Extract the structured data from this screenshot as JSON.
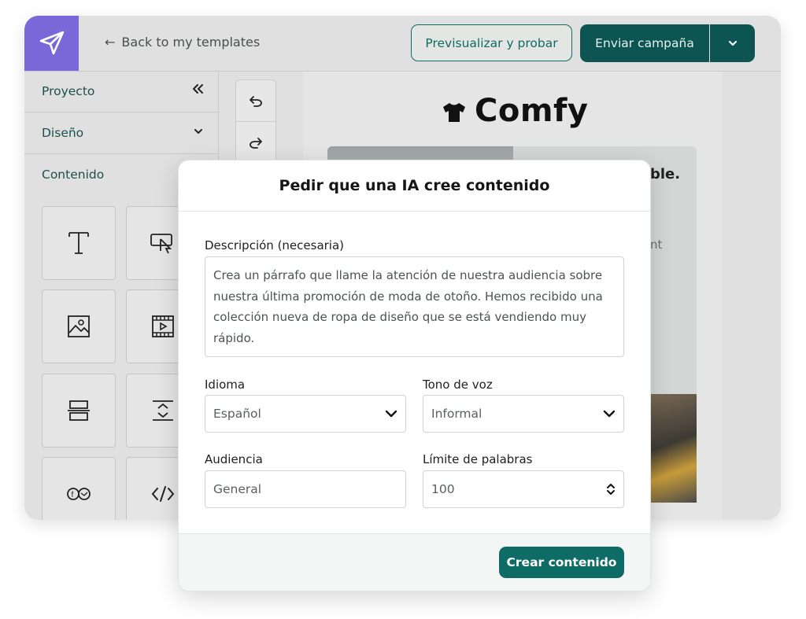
{
  "header": {
    "back_label": "Back to my templates",
    "preview_label": "Previsualizar y probar",
    "send_label": "Enviar campaña"
  },
  "sidebar": {
    "items": [
      {
        "label": "Proyecto",
        "icon": "double-chevron-left-icon"
      },
      {
        "label": "Diseño",
        "icon": "chevron-down-icon"
      },
      {
        "label": "Contenido"
      }
    ],
    "blocks": [
      {
        "icon": "text-block-icon"
      },
      {
        "icon": "button-block-icon"
      },
      {
        "icon": "image-block-icon"
      },
      {
        "icon": "video-block-icon"
      },
      {
        "icon": "divider-block-icon"
      },
      {
        "icon": "spacer-block-icon"
      },
      {
        "icon": "social-block-icon"
      },
      {
        "icon": "html-code-icon"
      }
    ]
  },
  "canvas": {
    "brand_name": "Comfy",
    "peek_heading": "ble.",
    "peek_text": "nt"
  },
  "modal": {
    "title": "Pedir que una IA cree contenido",
    "description_label": "Descripción (necesaria)",
    "description_value": "Crea un párrafo que llame la atención de nuestra audiencia sobre nuestra última promoción de moda de otoño. Hemos recibido una colección nueva de ropa de diseño que se está vendiendo muy rápido.",
    "language_label": "Idioma",
    "language_value": "Español",
    "tone_label": "Tono de voz",
    "tone_value": "Informal",
    "audience_label": "Audiencia",
    "audience_placeholder": "General",
    "word_limit_label": "Límite de palabras",
    "word_limit_value": "100",
    "create_label": "Crear contenido"
  },
  "colors": {
    "accent": "#0f6b66",
    "send_button": "#0d5552",
    "logo_bg": "#7a67d8"
  }
}
